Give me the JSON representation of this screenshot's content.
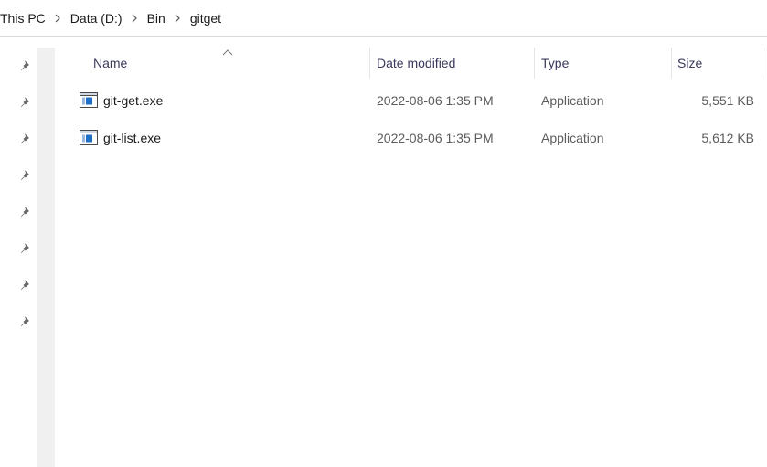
{
  "breadcrumb": {
    "items": [
      "This PC",
      "Data (D:)",
      "Bin",
      "gitget"
    ]
  },
  "pins": [
    "pin-icon",
    "pin-icon",
    "pin-icon",
    "pin-icon",
    "pin-icon",
    "pin-icon",
    "pin-icon",
    "pin-icon"
  ],
  "columns": {
    "name": "Name",
    "date_modified": "Date modified",
    "type": "Type",
    "size": "Size"
  },
  "files": [
    {
      "name": "git-get.exe",
      "date_modified": "2022-08-06 1:35 PM",
      "type": "Application",
      "size": "5,551 KB",
      "icon": "application-icon"
    },
    {
      "name": "git-list.exe",
      "date_modified": "2022-08-06 1:35 PM",
      "type": "Application",
      "size": "5,612 KB",
      "icon": "application-icon"
    }
  ],
  "colors": {
    "header_text": "#3a3a5c",
    "muted_text": "#5c5c5c",
    "app_icon_blue": "#1e6fc9"
  }
}
